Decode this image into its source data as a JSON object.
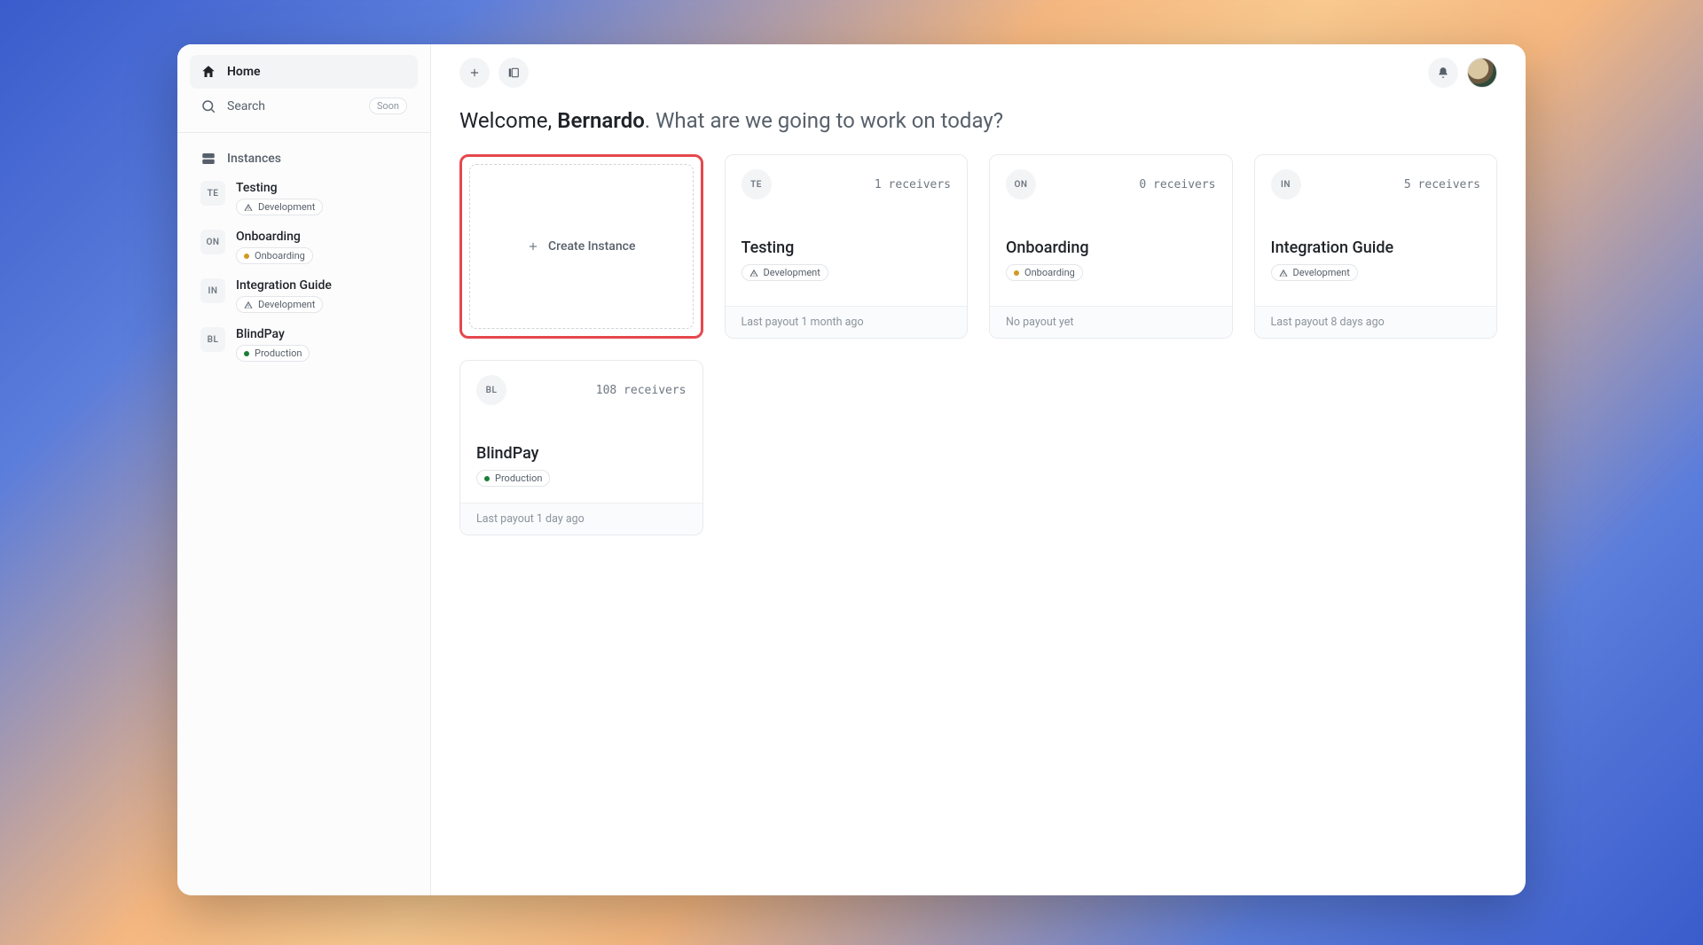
{
  "sidebar": {
    "home_label": "Home",
    "search_label": "Search",
    "search_badge": "Soon",
    "section_label": "Instances",
    "instances": [
      {
        "code": "TE",
        "name": "Testing",
        "env_label": "Development",
        "env_type": "warn"
      },
      {
        "code": "ON",
        "name": "Onboarding",
        "env_label": "Onboarding",
        "env_type": "orange"
      },
      {
        "code": "IN",
        "name": "Integration Guide",
        "env_label": "Development",
        "env_type": "warn"
      },
      {
        "code": "BL",
        "name": "BlindPay",
        "env_label": "Production",
        "env_type": "green"
      }
    ]
  },
  "welcome": {
    "prefix": "Welcome, ",
    "name": "Bernardo",
    "suffix": ". What are we going to work on today?"
  },
  "create_card": {
    "label": "Create Instance"
  },
  "cards": [
    {
      "code": "TE",
      "receivers": "1 receivers",
      "title": "Testing",
      "env_label": "Development",
      "env_type": "warn",
      "footer": "Last payout 1 month ago"
    },
    {
      "code": "ON",
      "receivers": "0 receivers",
      "title": "Onboarding",
      "env_label": "Onboarding",
      "env_type": "orange",
      "footer": "No payout yet"
    },
    {
      "code": "IN",
      "receivers": "5 receivers",
      "title": "Integration Guide",
      "env_label": "Development",
      "env_type": "warn",
      "footer": "Last payout 8 days ago"
    },
    {
      "code": "BL",
      "receivers": "108 receivers",
      "title": "BlindPay",
      "env_label": "Production",
      "env_type": "green",
      "footer": "Last payout 1 day ago"
    }
  ]
}
